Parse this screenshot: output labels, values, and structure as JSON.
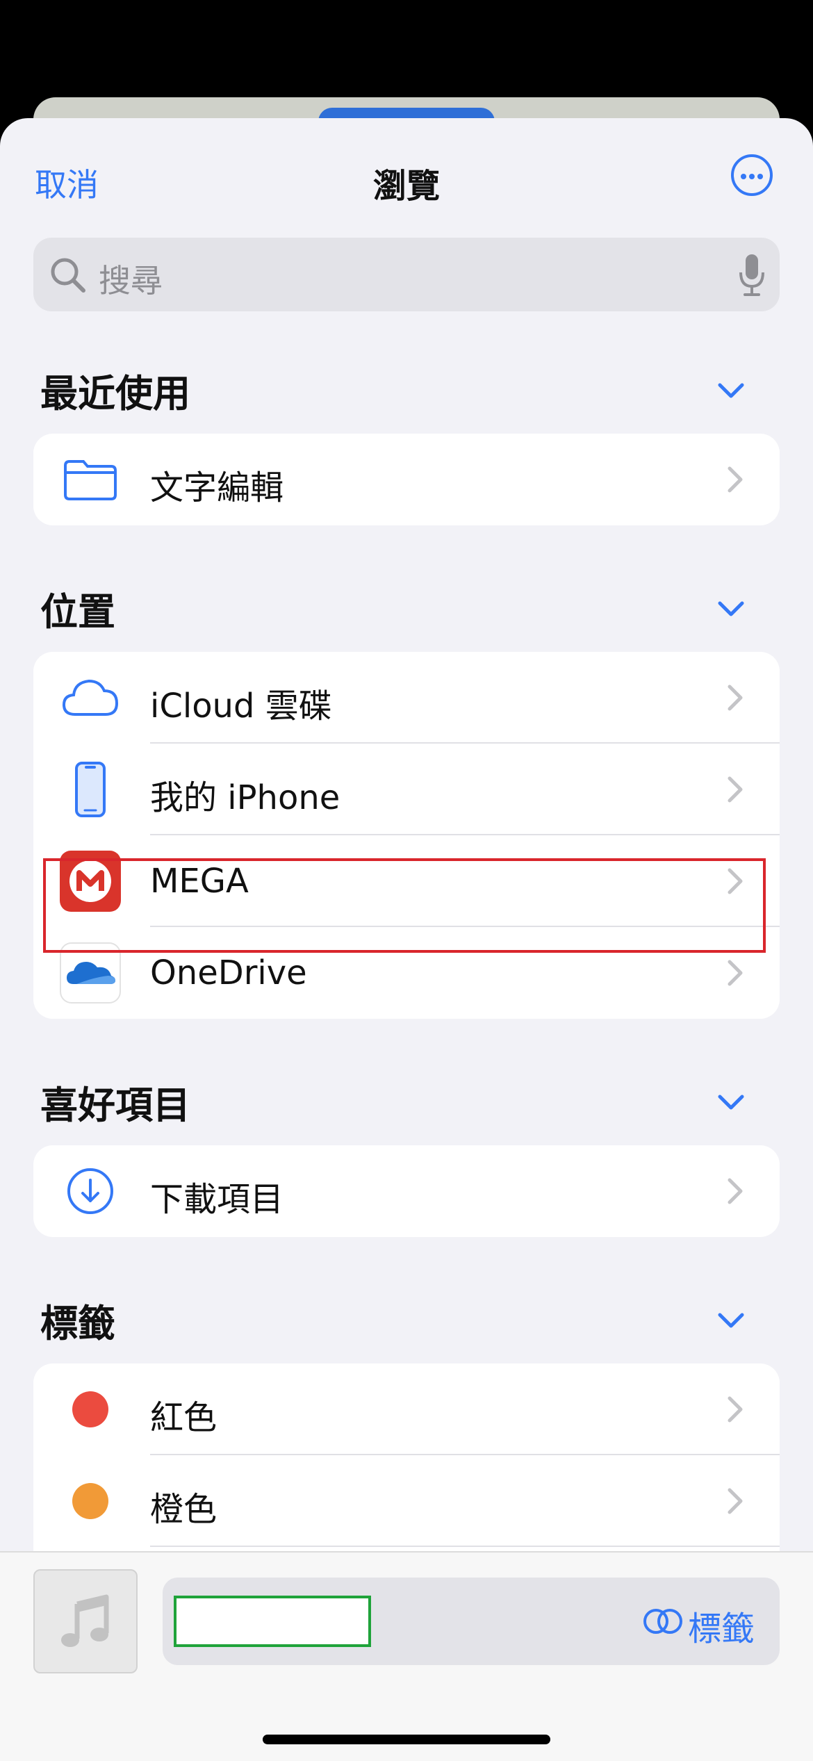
{
  "nav": {
    "cancel_label": "取消",
    "title": "瀏覽"
  },
  "search": {
    "placeholder": "搜尋"
  },
  "sections": {
    "recent": {
      "title": "最近使用",
      "items": [
        {
          "label": "文字編輯"
        }
      ]
    },
    "locations": {
      "title": "位置",
      "items": [
        {
          "label": "iCloud 雲碟"
        },
        {
          "label": "我的 iPhone"
        },
        {
          "label": "MEGA"
        },
        {
          "label": "OneDrive"
        }
      ]
    },
    "favorites": {
      "title": "喜好項目",
      "items": [
        {
          "label": "下載項目"
        }
      ]
    },
    "tags": {
      "title": "標籤",
      "items": [
        {
          "label": "紅色",
          "color": "#eb4b3f"
        },
        {
          "label": "橙色",
          "color": "#f19a37"
        }
      ]
    }
  },
  "bottom_bar": {
    "file_name_value": "",
    "tags_label": "標籤"
  },
  "colors": {
    "accent": "#3478f6",
    "highlight": "#d9262c",
    "input_border": "#1fa33a",
    "mega_red": "#d9342b",
    "onedrive_blue": "#1e6fd0"
  }
}
